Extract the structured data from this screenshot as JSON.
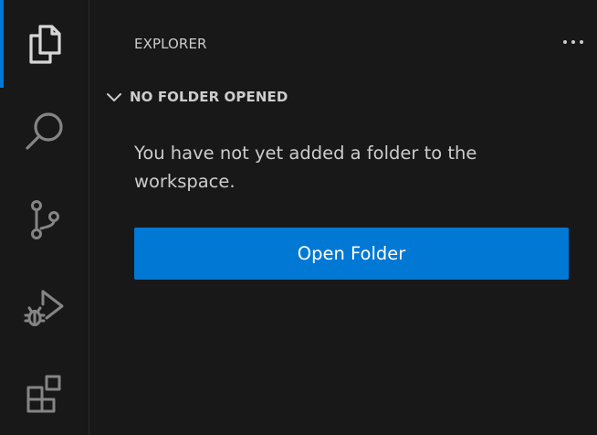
{
  "activity_bar": {
    "items": [
      {
        "name": "explorer",
        "icon": "files-icon",
        "active": true
      },
      {
        "name": "search",
        "icon": "search-icon",
        "active": false
      },
      {
        "name": "source-control",
        "icon": "source-control-icon",
        "active": false
      },
      {
        "name": "run-and-debug",
        "icon": "run-debug-icon",
        "active": false
      },
      {
        "name": "extensions",
        "icon": "extensions-icon",
        "active": false
      }
    ]
  },
  "sidebar": {
    "title": "EXPLORER",
    "more_actions_icon": "ellipsis-icon",
    "section": {
      "title": "NO FOLDER OPENED",
      "chevron_icon": "chevron-down-icon",
      "expanded": true
    },
    "message": "You have not yet added a folder to the workspace.",
    "open_folder_label": "Open Folder"
  },
  "colors": {
    "background": "#181818",
    "icon": "#cccccc",
    "text": "#cccccc",
    "accent": "#0078d4",
    "button_text": "#ffffff"
  }
}
